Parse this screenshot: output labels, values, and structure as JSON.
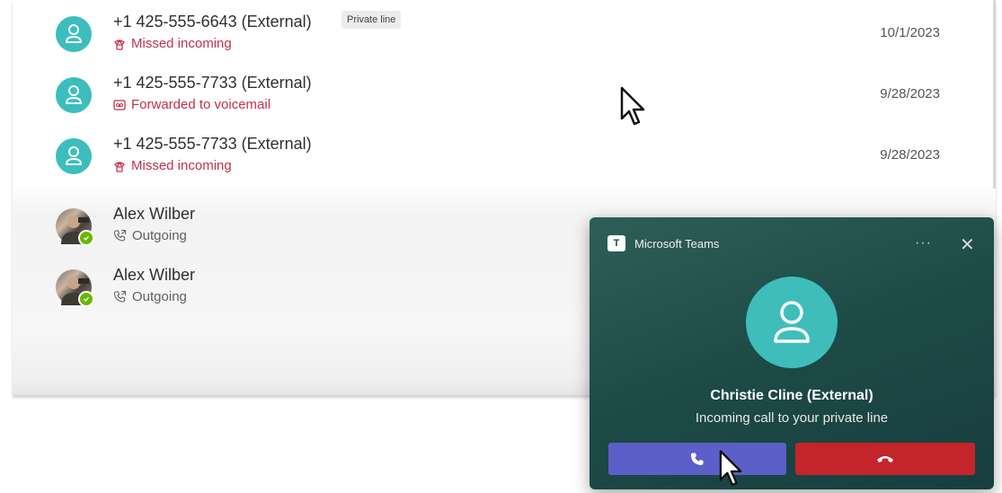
{
  "history": {
    "rows": [
      {
        "name": "+1 425-555-6643 (External)",
        "badge": "Private line",
        "status": "Missed incoming",
        "status_icon": "missed-call-icon",
        "date": "10/1/2023"
      },
      {
        "name": "+1 425-555-7733 (External)",
        "status": "Forwarded to voicemail",
        "status_icon": "voicemail-icon",
        "date": "9/28/2023"
      },
      {
        "name": "+1 425-555-7733 (External)",
        "status": "Missed incoming",
        "status_icon": "missed-call-icon",
        "date": "9/28/2023"
      },
      {
        "name": "Alex Wilber",
        "status": "Outgoing",
        "status_icon": "outgoing-call-icon",
        "presence": "available"
      },
      {
        "name": "Alex Wilber",
        "status": "Outgoing",
        "status_icon": "outgoing-call-icon",
        "presence": "available"
      }
    ]
  },
  "toast": {
    "app_name": "Microsoft Teams",
    "more_label": "···",
    "close_label": "✕",
    "caller_name": "Christie Cline (External)",
    "caller_status": "Incoming call to your private line",
    "accept_icon": "phone-icon",
    "decline_icon": "hang-up-icon"
  },
  "colors": {
    "accent_teal": "#3dbdbd",
    "missed_red": "#c4314b",
    "accept_purple": "#5b5fc7",
    "decline_red": "#c4252b",
    "toast_bg": "#1d4a47",
    "presence_green": "#6bb700"
  }
}
